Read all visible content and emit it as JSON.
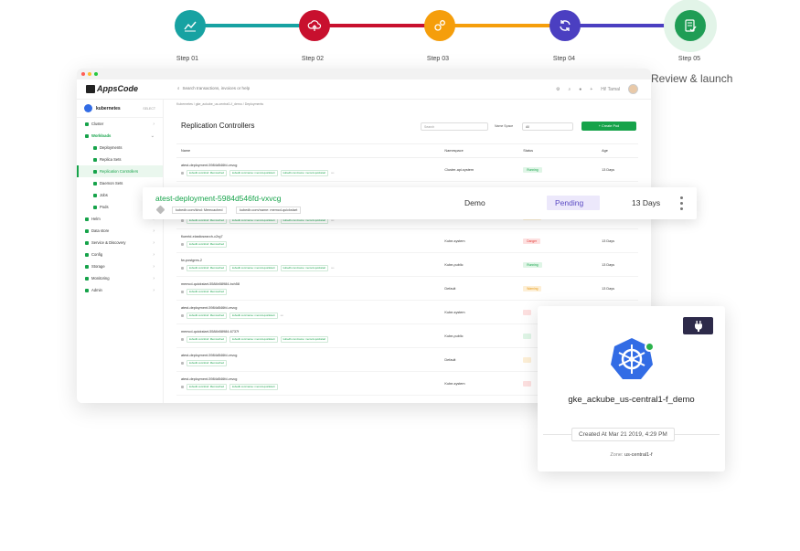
{
  "stepper": {
    "steps": [
      {
        "label": "Step 01",
        "color": "#17a2a2",
        "icon": "chart-line-icon"
      },
      {
        "label": "Step 02",
        "color": "#c8102e",
        "icon": "cloud-upload-icon"
      },
      {
        "label": "Step 03",
        "color": "#f59e0b",
        "icon": "gears-icon"
      },
      {
        "label": "Step 04",
        "color": "#4b3fc1",
        "icon": "sync-icon"
      },
      {
        "label": "Step 05",
        "color": "#1f9d55",
        "icon": "checklist-icon"
      }
    ],
    "current_caption": "Review & launch"
  },
  "app": {
    "logo": "AppsCode",
    "search_placeholder": "Search transactions, invoices or help",
    "user": "Hi! Tamal",
    "sidebar": {
      "title": "kubernetes",
      "version": "SELECT",
      "items": [
        {
          "label": "Cluster",
          "sub": false
        },
        {
          "label": "Workloads",
          "sub": false,
          "state": "active-parent"
        },
        {
          "label": "Deployments",
          "sub": true
        },
        {
          "label": "Replica Sets",
          "sub": true
        },
        {
          "label": "Replication Controllers",
          "sub": true,
          "state": "active"
        },
        {
          "label": "Daemon Sets",
          "sub": true
        },
        {
          "label": "Jobs",
          "sub": true
        },
        {
          "label": "Pods",
          "sub": true
        },
        {
          "label": "Helm",
          "sub": false
        },
        {
          "label": "Data store",
          "sub": false
        },
        {
          "label": "Service & Discovery",
          "sub": false
        },
        {
          "label": "Config",
          "sub": false
        },
        {
          "label": "Storage",
          "sub": false
        },
        {
          "label": "Monitoring",
          "sub": false
        },
        {
          "label": "Admin",
          "sub": false
        }
      ]
    },
    "breadcrumb": "Kubernetes / gke_ackube_us-central1-f_demo / Deployments",
    "panel": {
      "title": "Replication Controllers",
      "search_placeholder": "Search",
      "namespace_label": "Name Space",
      "namespace_value": "All",
      "create_button": "+ Create Pod"
    },
    "table": {
      "headers": [
        "Name",
        "Namespace",
        "Status",
        "Age"
      ],
      "rows": [
        {
          "name": "atest-deployment-5984d546fd-vxvcg",
          "tags": [
            "kubedb.com/kind: Memcached",
            "kubedb.com/name: memcd-quickstart",
            "kubedb.com/name: memcd-quickstart"
          ],
          "more": true,
          "namespace": "Cluster-api-system",
          "status": "Running",
          "status_type": "running",
          "age": "13 Days"
        },
        {
          "name": "",
          "tags": [],
          "more": false,
          "namespace": "",
          "status": "",
          "status_type": "",
          "age": ""
        },
        {
          "name": "fluentd-elasticsearch-2xrrp",
          "tags": [
            "kubedb.com/kind: Memcached",
            "kubedb.com/name: memcd-quickstart",
            "kubedb.com/name: memcd-quickstart"
          ],
          "more": true,
          "namespace": "Default",
          "status": "Warning",
          "status_type": "warning",
          "age": "13 Days"
        },
        {
          "name": "fluentd-elasticsearch-c2rg7",
          "tags": [
            "kubedb.com/kind: Memcached"
          ],
          "more": false,
          "namespace": "Kube-system",
          "status": "Danger",
          "status_type": "danger",
          "age": "13 Days"
        },
        {
          "name": "fw-postgres-2",
          "tags": [
            "kubedb.com/kind: Memcached",
            "kubedb.com/name: memcd-quickstart",
            "kubedb.com/name: memcd-quickstart"
          ],
          "more": true,
          "namespace": "Kube-public",
          "status": "Running",
          "status_type": "running",
          "age": "13 Days"
        },
        {
          "name": "memcd-quickstart-5584b58984-bch58",
          "tags": [
            "kubedb.com/kind: Memcached"
          ],
          "more": false,
          "namespace": "Default",
          "status": "Warning",
          "status_type": "warning",
          "age": "13 Days"
        },
        {
          "name": "atest-deployment-5984d546fd-vxvcg",
          "tags": [
            "kubedb.com/kind: Memcached",
            "kubedb.com/name: memcd-quickstart"
          ],
          "more": true,
          "namespace": "Kube-system",
          "status": "",
          "status_type": "danger",
          "age": ""
        },
        {
          "name": "memcd-quickstart-5584b58984-6737f",
          "tags": [
            "kubedb.com/kind: Memcached",
            "kubedb.com/name: memcd-quickstart",
            "kubedb.com/name: memcd-quickstart"
          ],
          "more": false,
          "namespace": "Kube-public",
          "status": "",
          "status_type": "running",
          "age": ""
        },
        {
          "name": "atest-deployment-5984d546fd-vxvcg",
          "tags": [
            "kubedb.com/kind: Memcached"
          ],
          "more": false,
          "namespace": "Default",
          "status": "",
          "status_type": "warning",
          "age": ""
        },
        {
          "name": "atest-deployment-5984d546fd-vxvcg",
          "tags": [
            "kubedb.com/kind: Memcached",
            "kubedb.com/name: memcd-quickstart"
          ],
          "more": false,
          "namespace": "Kube-system",
          "status": "",
          "status_type": "danger",
          "age": ""
        }
      ]
    }
  },
  "highlight_row": {
    "name": "atest-deployment-5984d546fd-vxvcg",
    "tag1": "kubedb.com/kind: Memcached",
    "tag2": "kubedb.com/name: memcd-quickstart",
    "namespace": "Demo",
    "status": "Pending",
    "age": "13 Days"
  },
  "cluster_card": {
    "name": "gke_ackube_us-central1-f_demo",
    "created": "Created At Mar 21 2019, 4:29 PM",
    "zone_label": "Zone:",
    "zone_value": "us-central1-f",
    "status_color": "#2bb24c"
  }
}
